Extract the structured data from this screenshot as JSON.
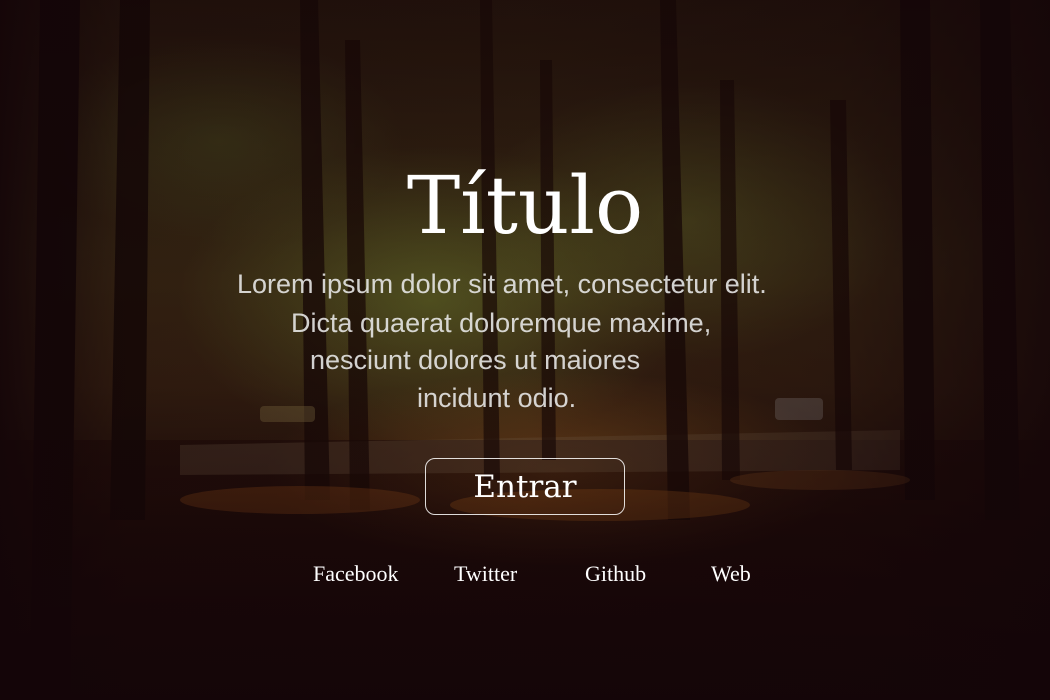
{
  "hero": {
    "title": "Título",
    "description_lines": [
      "Lorem ipsum dolor sit amet, consectetur elit.",
      "Dicta quaerat doloremque maxime,",
      "nesciunt dolores ut maiores",
      "incidunt odio."
    ],
    "button_label": "Entrar"
  },
  "social_links": [
    {
      "label": "Facebook"
    },
    {
      "label": "Twitter"
    },
    {
      "label": "Github"
    },
    {
      "label": "Web"
    }
  ],
  "colors": {
    "text": "#ffffff",
    "overlay": "#150507"
  }
}
